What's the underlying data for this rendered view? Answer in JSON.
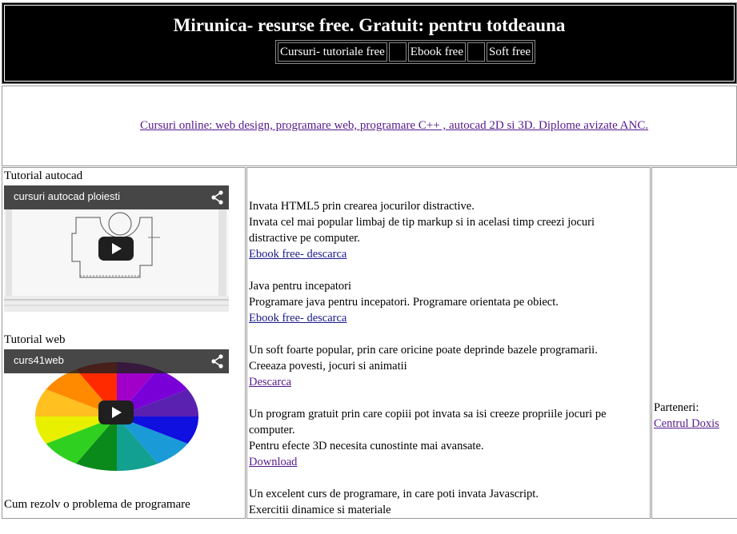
{
  "header": {
    "title": "Mirunica- resurse free. Gratuit: pentru totdeauna",
    "nav": [
      "Cursuri- tutoriale free",
      "Ebook free",
      "Soft free"
    ]
  },
  "banner": {
    "link": "Cursuri online: web design, programare web, programare C++ , autocad 2D si 3D. Diplome avizate ANC."
  },
  "left": {
    "autocad_label": "Tutorial autocad",
    "autocad_video_title": "cursuri autocad ploiesti",
    "web_label": "Tutorial web",
    "web_video_title": "curs41web",
    "bottom_label": "Cum rezolv o problema de programare"
  },
  "main": {
    "items": [
      {
        "title": "Invata HTML5 prin crearea jocurilor distractive.",
        "desc": "Invata cel mai popular limbaj de tip markup si in acelasi timp creezi jocuri distractive pe computer.",
        "link": "Ebook free- descarca"
      },
      {
        "title": "Java pentru incepatori",
        "desc": "Programare java pentru incepatori. Programare orientata pe obiect.",
        "link": "Ebook free- descarca"
      },
      {
        "title": "Un soft foarte popular, prin care oricine poate deprinde bazele programarii.",
        "desc": "Creeaza povesti, jocuri si animatii",
        "link": "Descarca"
      },
      {
        "title": "Un program gratuit prin care copiii pot invata sa isi creeze propriile jocuri pe computer.",
        "desc": "Pentru efecte 3D necesita cunostinte mai avansate.",
        "link": "Download"
      },
      {
        "title": "Un excelent curs de programare, in care poti invata Javascript.",
        "desc": "Exercitii dinamice si materiale",
        "link": ""
      }
    ]
  },
  "right": {
    "partners_label": "Parteneri:",
    "partner_link": "Centrul Doxis"
  },
  "colors": {
    "header_bg": "#000000",
    "visited_link": "#551a8b",
    "link": "#1a1a8b"
  }
}
